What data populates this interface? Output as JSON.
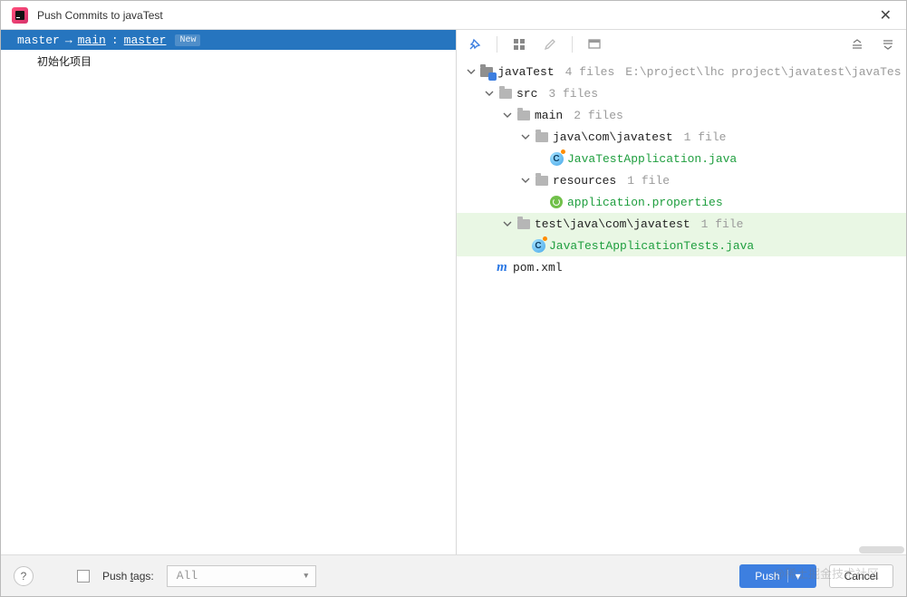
{
  "title": "Push Commits to javaTest",
  "branch": {
    "local": "master",
    "arrow": "→",
    "remote": "main",
    "sep": ":",
    "tracking": "master",
    "badge": "New"
  },
  "commits": [
    {
      "message": "初始化项目"
    }
  ],
  "tree": {
    "root": {
      "name": "javaTest",
      "meta": "4 files",
      "path": "E:\\project\\lhc project\\javatest\\javaTest"
    },
    "src": {
      "name": "src",
      "meta": "3 files"
    },
    "main": {
      "name": "main",
      "meta": "2 files"
    },
    "javaPkg": {
      "name": "java\\com\\javatest",
      "meta": "1 file"
    },
    "appClass": {
      "name": "JavaTestApplication.java"
    },
    "resources": {
      "name": "resources",
      "meta": "1 file"
    },
    "appProps": {
      "name": "application.properties"
    },
    "testPkg": {
      "name": "test\\java\\com\\javatest",
      "meta": "1 file"
    },
    "testClass": {
      "name": "JavaTestApplicationTests.java"
    },
    "pom": {
      "name": "pom.xml"
    }
  },
  "bottom": {
    "push_tags_label_prefix": "Push ",
    "push_tags_label_u": "t",
    "push_tags_label_suffix": "ags:",
    "combo_value": "All",
    "push_btn": "Push",
    "cancel_btn": "Cancel"
  },
  "watermark": "@稀土掘金技术社区"
}
